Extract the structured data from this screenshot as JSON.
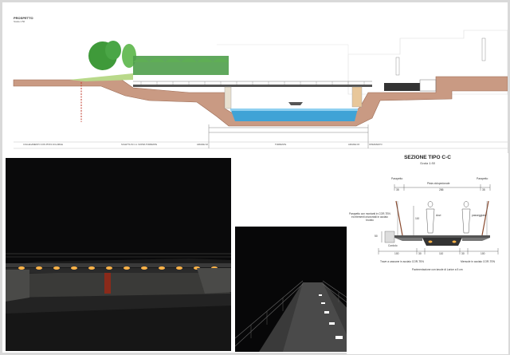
{
  "elevation": {
    "title": "PROSPETTO",
    "scale": "Scala 1:50",
    "bottom_labels": [
      "COLLEGAMENTO CON PISTA CICLABILE",
      "SOLETTA IN C.A. SOPRA TORRENTE",
      "ARGINE SX",
      "TORRENTE",
      "ARGINE DX",
      "INTERVENTO"
    ]
  },
  "section": {
    "title": "SEZIONE TIPO C-C",
    "scale": "Scala 1:50",
    "parapetto_left": "Parapetto",
    "parapetto_right": "Parapetto",
    "pista": "Pista ciclopedonale",
    "dim_left": "35",
    "dim_center": "286",
    "dim_right": "35",
    "note_left": "Parapetto con montanti in COR-TEN ed elementi orizzontali in acciaio brunito",
    "cordolo": "Cordolo",
    "rail_h": "110",
    "h_dim": "50",
    "fig_label_a": "Anzi",
    "fig_label_b": "passeggiata",
    "bottom_dims": [
      "100",
      "30",
      "110",
      "30",
      "100"
    ],
    "trave": "Trave a cassone in acciaio COR-TEN",
    "mensole": "Mensole in acciaio COR-TEN",
    "pavimentazione": "Pavimentazione con tavole di Larice a 5 cm"
  },
  "colors": {
    "water": "#3fa3d6",
    "ground": "#c99a83",
    "tree": "#3f9a3a",
    "corten": "#8a4a2e",
    "light": "#ffb347"
  }
}
